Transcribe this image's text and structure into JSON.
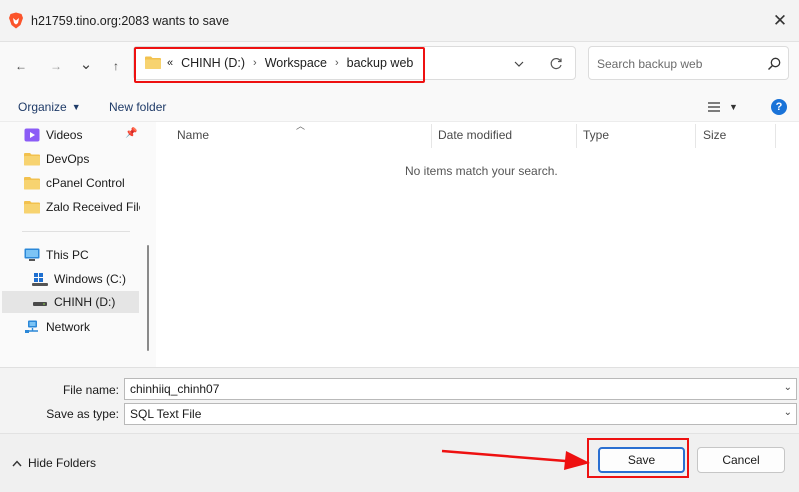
{
  "window": {
    "title": "h21759.tino.org:2083 wants to save"
  },
  "nav": {
    "back": "←",
    "forward": "→",
    "recent": "⌄",
    "up": "↑"
  },
  "address": {
    "prefix": "«",
    "crumbs": [
      "CHINH (D:)",
      "Workspace",
      "backup web"
    ],
    "separator": "›"
  },
  "search": {
    "placeholder": "Search backup web"
  },
  "toolbar": {
    "organize": "Organize",
    "new_folder": "New folder",
    "help": "?"
  },
  "sidebar": {
    "items": [
      {
        "label": "Videos",
        "icon": "videos-icon"
      },
      {
        "label": "DevOps",
        "icon": "folder-icon"
      },
      {
        "label": "cPanel Control",
        "icon": "folder-icon"
      },
      {
        "label": "Zalo Received Files",
        "icon": "folder-icon"
      },
      {
        "label": "This PC",
        "icon": "pc-icon"
      },
      {
        "label": "Windows (C:)",
        "icon": "windows-drive-icon"
      },
      {
        "label": "CHINH (D:)",
        "icon": "drive-icon"
      },
      {
        "label": "Network",
        "icon": "network-icon"
      }
    ]
  },
  "columns": [
    "Name",
    "Date modified",
    "Type",
    "Size"
  ],
  "content": {
    "empty_message": "No items match your search."
  },
  "form": {
    "file_name_label": "File name:",
    "file_name_value": "chinhiiq_chinh07",
    "type_label": "Save as type:",
    "type_value": "SQL Text File"
  },
  "footer": {
    "hide_folders": "Hide Folders",
    "save": "Save",
    "cancel": "Cancel"
  },
  "colors": {
    "accent": "#1a73d8",
    "highlight": "#e11111",
    "folder": "#f2c14e"
  }
}
